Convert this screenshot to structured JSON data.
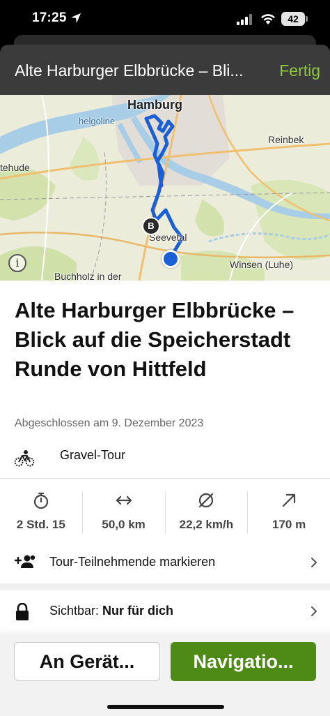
{
  "status_bar": {
    "time": "17:25",
    "battery": "42"
  },
  "header": {
    "title": "Alte Harburger Elbbrücke – Bli...",
    "done_label": "Fertig"
  },
  "map": {
    "labels": {
      "hamburg": "Hamburg",
      "helgoline": "helgoline",
      "reinbek": "Reinbek",
      "hude": "tehude",
      "seevetal": "Seevetal",
      "winsen": "Winsen (Luhe)",
      "buchholz": "Buchholz in der"
    },
    "marker_b": "B",
    "route_color": "#1a5fd6"
  },
  "tour": {
    "title": "Alte Harburger Elbbrücke – Blick auf die Speicherstadt Runde von Hittfeld",
    "date": "Abgeschlossen am 9. Dezember 2023",
    "sport": "Gravel-Tour"
  },
  "stats": [
    {
      "icon": "stopwatch-icon",
      "value": "2 Std. 15"
    },
    {
      "icon": "distance-icon",
      "value": "50,0 km"
    },
    {
      "icon": "average-speed-icon",
      "value": "22,2 km/h"
    },
    {
      "icon": "elevation-up-icon",
      "value": "170 m"
    }
  ],
  "participants": {
    "label": "Tour-Teilnehmende markieren"
  },
  "visibility": {
    "prefix": "Sichtbar: ",
    "value": "Nur für dich"
  },
  "actions": {
    "device_label": "An Gerät...",
    "navigation_label": "Navigatio..."
  },
  "colors": {
    "accent_green": "#8ec741",
    "nav_button": "#4e8a16",
    "header_bg": "#3b3b3b"
  }
}
